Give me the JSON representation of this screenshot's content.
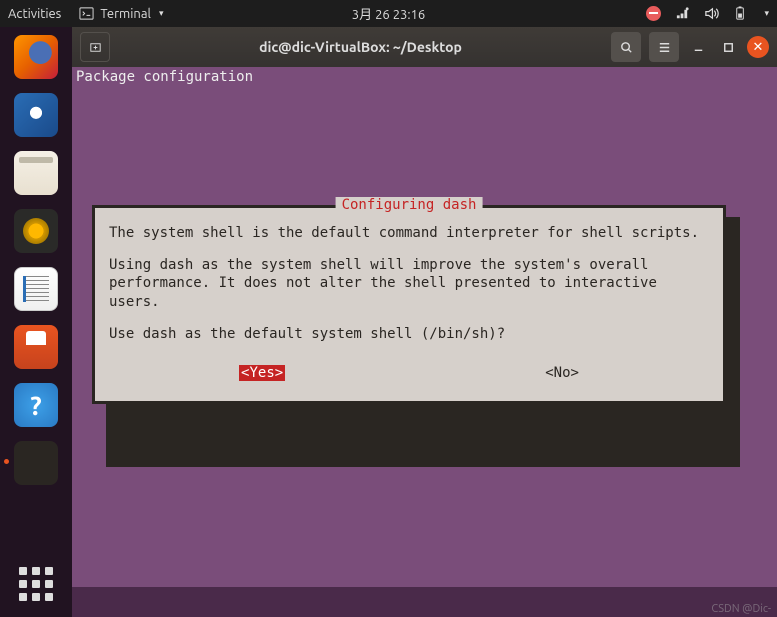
{
  "topbar": {
    "activities": "Activities",
    "app": "Terminal",
    "time": "3月 26  23:16"
  },
  "window": {
    "title": "dic@dic-VirtualBox: ~/Desktop"
  },
  "terminal": {
    "header": "Package configuration",
    "dialog_title": "Configuring dash",
    "body1": "The system shell is the default command interpreter for shell scripts.",
    "body2": "Using dash as the system shell will improve the system's overall performance. It does not alter the shell presented to interactive users.",
    "body3": "Use dash as the default system shell (/bin/sh)?",
    "yes": "<Yes>",
    "no": "<No>"
  },
  "watermark": "CSDN @Dic-"
}
